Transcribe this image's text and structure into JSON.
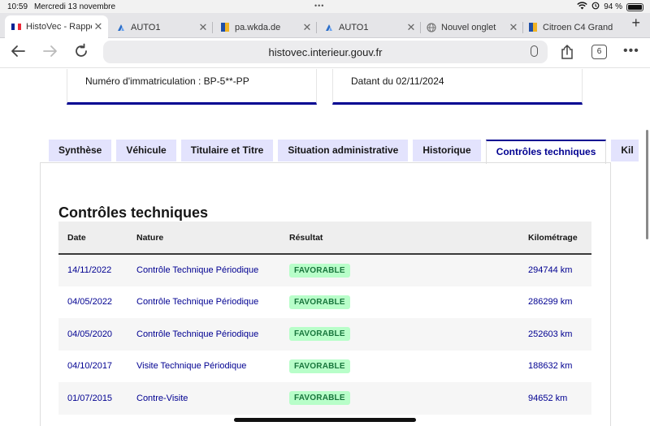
{
  "status_bar": {
    "time": "10:59",
    "date": "Mercredi 13 novembre",
    "battery": "94 %",
    "battery_level": 0.94
  },
  "browser_tabs": [
    {
      "title": "HistoVec - Rappo",
      "favicon": "french-flag-icon",
      "active": true
    },
    {
      "title": "AUTO1",
      "favicon": "auto1-icon",
      "active": false
    },
    {
      "title": "pa.wkda.de",
      "favicon": "wkda-icon",
      "active": false
    },
    {
      "title": "AUTO1",
      "favicon": "auto1-icon",
      "active": false
    },
    {
      "title": "Nouvel onglet",
      "favicon": "globe-icon",
      "active": false
    },
    {
      "title": "Citroen C4 Grand",
      "favicon": "wkda-icon",
      "active": false
    }
  ],
  "toolbar": {
    "url": "histovec.interieur.gouv.fr",
    "tab_count": "6"
  },
  "cards": {
    "registration": "Numéro d'immatriculation : BP-5**-PP",
    "dated": "Datant du 02/11/2024"
  },
  "content_tabs": [
    {
      "label": "Synthèse",
      "active": false
    },
    {
      "label": "Véhicule",
      "active": false
    },
    {
      "label": "Titulaire et Titre",
      "active": false
    },
    {
      "label": "Situation administrative",
      "active": false
    },
    {
      "label": "Historique",
      "active": false
    },
    {
      "label": "Contrôles techniques",
      "active": true
    },
    {
      "label": "Kil",
      "active": false
    }
  ],
  "section_title": "Contrôles techniques",
  "table": {
    "headers": {
      "date": "Date",
      "nature": "Nature",
      "result": "Résultat",
      "mileage": "Kilométrage"
    },
    "rows": [
      {
        "date": "14/11/2022",
        "nature": "Contrôle Technique Périodique",
        "result": "FAVORABLE",
        "mileage": "294744 km"
      },
      {
        "date": "04/05/2022",
        "nature": "Contrôle Technique Périodique",
        "result": "FAVORABLE",
        "mileage": "286299 km"
      },
      {
        "date": "04/05/2020",
        "nature": "Contrôle Technique Périodique",
        "result": "FAVORABLE",
        "mileage": "252603 km"
      },
      {
        "date": "04/10/2017",
        "nature": "Visite Technique Périodique",
        "result": "FAVORABLE",
        "mileage": "188632 km"
      },
      {
        "date": "01/07/2015",
        "nature": "Contre-Visite",
        "result": "FAVORABLE",
        "mileage": "94652 km"
      }
    ]
  },
  "colors": {
    "accent": "#000091",
    "badge_bg": "#b8fec9",
    "badge_text": "#18753c",
    "tab_bg": "#e3e3fd"
  }
}
